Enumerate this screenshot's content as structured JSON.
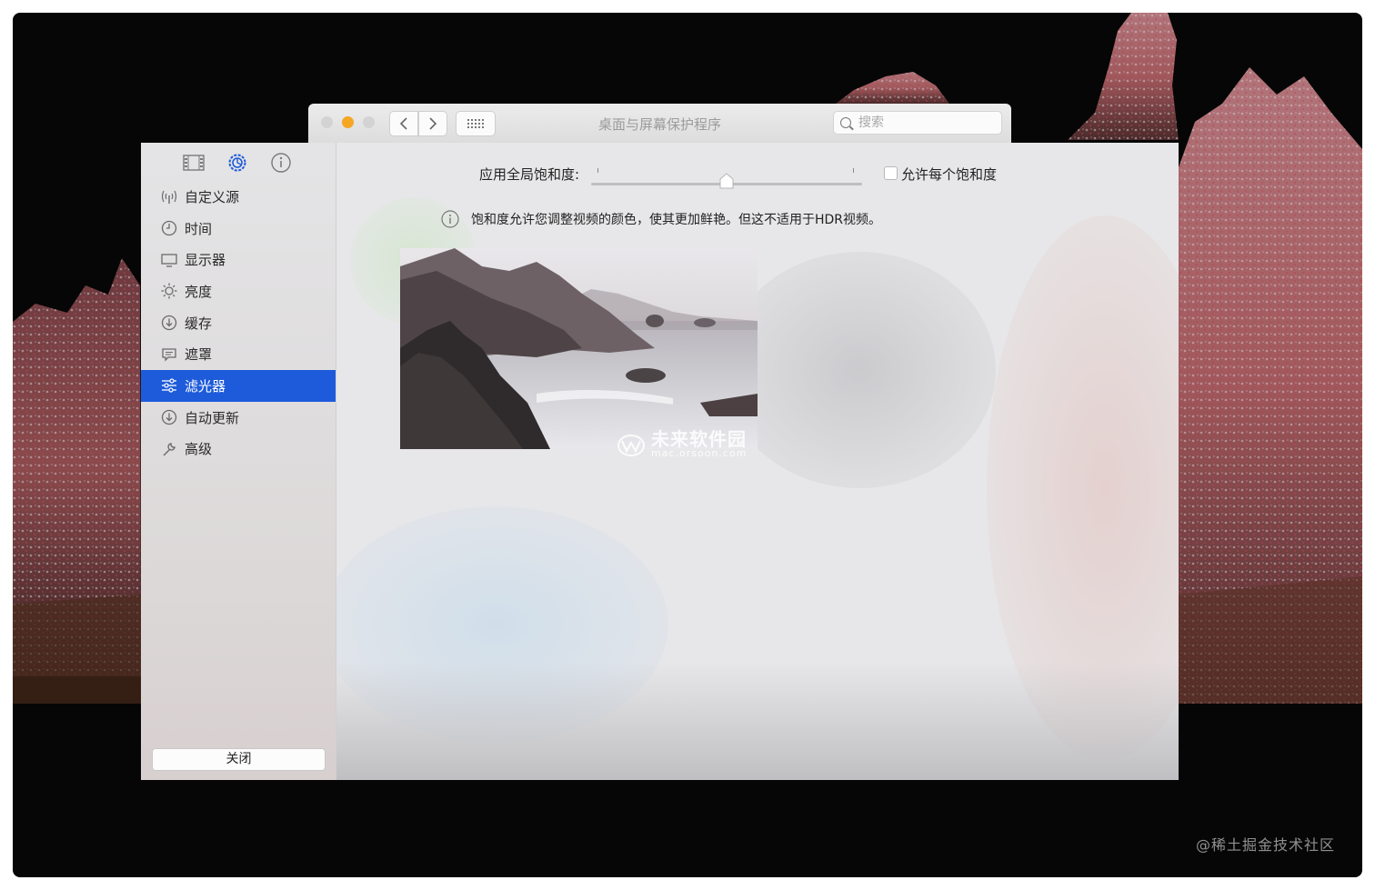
{
  "prefs_window": {
    "title": "桌面与屏幕保护程序",
    "search_placeholder": "搜索"
  },
  "sidebar": {
    "items": [
      {
        "label": "自定义源",
        "icon": "antenna-icon"
      },
      {
        "label": "时间",
        "icon": "clock-icon"
      },
      {
        "label": "显示器",
        "icon": "display-icon"
      },
      {
        "label": "亮度",
        "icon": "sun-icon"
      },
      {
        "label": "缓存",
        "icon": "download-circle-icon"
      },
      {
        "label": "遮罩",
        "icon": "speech-bubble-icon"
      },
      {
        "label": "滤光器",
        "icon": "sliders-icon",
        "active": true
      },
      {
        "label": "自动更新",
        "icon": "download-circle-icon"
      },
      {
        "label": "高级",
        "icon": "wrench-icon"
      }
    ],
    "close_label": "关闭"
  },
  "content": {
    "saturation_label": "应用全局饱和度:",
    "slider_value": 0.5,
    "per_video_label": "允许每个饱和度",
    "info_text": "饱和度允许您调整视频的颜色，使其更加鲜艳。但这不适用于HDR视频。",
    "watermark_title": "未来软件园",
    "watermark_url": "mac.orsoon.com"
  },
  "corner_watermark": "@稀土掘金技术社区",
  "colors": {
    "accent": "#1e5bdb",
    "traffic_close": "#d3d3d3",
    "traffic_minimize": "#f5a623",
    "traffic_zoom": "#d3d3d3"
  }
}
